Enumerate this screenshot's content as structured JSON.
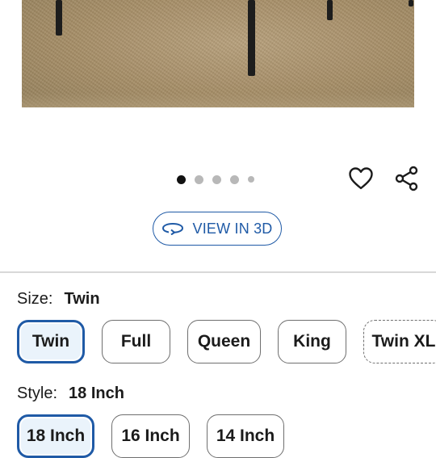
{
  "gallery": {
    "image_alt": "Bed frame with black metal legs on a jute rug",
    "dots": [
      {
        "active": true
      },
      {
        "active": false
      },
      {
        "active": false
      },
      {
        "active": false
      },
      {
        "active": false,
        "small": true
      }
    ]
  },
  "actions": {
    "favorite_icon": "heart-icon",
    "share_icon": "share-icon"
  },
  "view3d": {
    "label": "VIEW IN 3D",
    "icon": "rotate-3d-icon"
  },
  "size": {
    "label": "Size:",
    "selected": "Twin",
    "options": [
      "Twin",
      "Full",
      "Queen",
      "King",
      "Twin XL"
    ]
  },
  "style": {
    "label": "Style:",
    "selected": "18 Inch",
    "options": [
      "18 Inch",
      "16 Inch",
      "14 Inch"
    ]
  },
  "colors": {
    "accent": "#1f5aa6",
    "selected_bg": "#eaf3fb"
  }
}
